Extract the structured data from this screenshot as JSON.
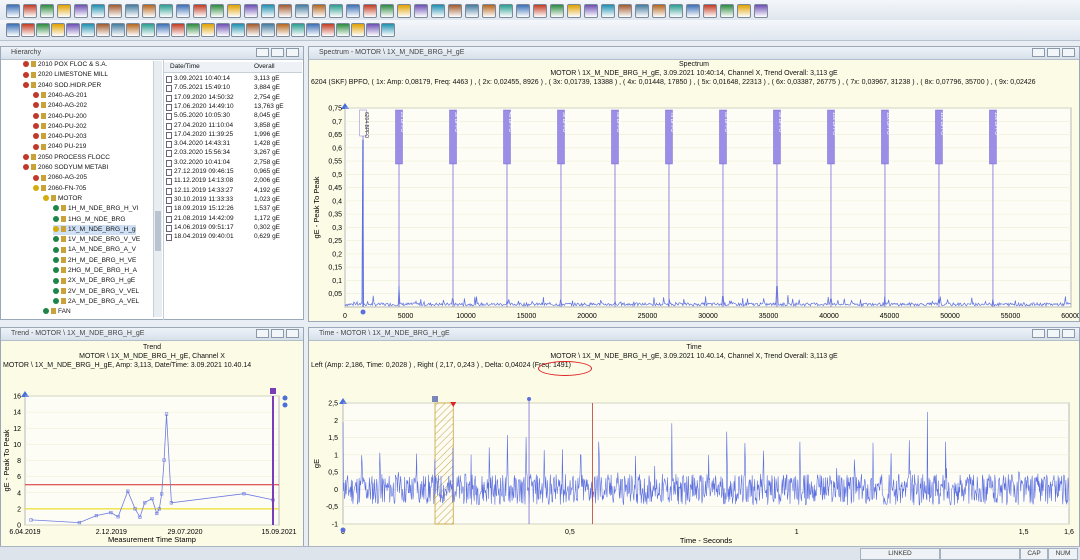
{
  "hierarchy": {
    "title": "Hierarchy",
    "items": [
      {
        "label": "2010 POX FLOC & S.A.",
        "indent": 0,
        "status": "#c0392b"
      },
      {
        "label": "2020 LIMESTONE MILL",
        "indent": 0,
        "status": "#c0392b"
      },
      {
        "label": "2040 SOD.HIDR.PER",
        "indent": 0,
        "status": "#c0392b"
      },
      {
        "label": "2040-AG-201",
        "indent": 1,
        "status": "#c0392b"
      },
      {
        "label": "2040-AG-202",
        "indent": 1,
        "status": "#c0392b"
      },
      {
        "label": "2040-PU-200",
        "indent": 1,
        "status": "#c0392b"
      },
      {
        "label": "2040-PU-202",
        "indent": 1,
        "status": "#c0392b"
      },
      {
        "label": "2040-PU-203",
        "indent": 1,
        "status": "#c0392b"
      },
      {
        "label": "2040 PU-219",
        "indent": 1,
        "status": "#c0392b"
      },
      {
        "label": "2050 PROCESS FLOCC",
        "indent": 0,
        "status": "#c0392b"
      },
      {
        "label": "2060 SODYUM METABI",
        "indent": 0,
        "status": "#c0392b"
      },
      {
        "label": "2060-AG-205",
        "indent": 1,
        "status": "#c0392b"
      },
      {
        "label": "2060-FN-705",
        "indent": 1,
        "status": "#d4ac0d"
      },
      {
        "label": "MOTOR",
        "indent": 2,
        "status": "#d4ac0d"
      },
      {
        "label": "1H_M_NDE_BRG_H_VI",
        "indent": 3,
        "status": "#1e8449"
      },
      {
        "label": "1HG_M_NDE_BRG",
        "indent": 3,
        "status": "#1e8449"
      },
      {
        "label": "1X_M_NDE_BRG_H_g",
        "indent": 3,
        "status": "#d4ac0d"
      },
      {
        "label": "1V_M_NDE_BRG_V_VE",
        "indent": 3,
        "status": "#1e8449"
      },
      {
        "label": "1A_M_NDE_BRG_A_V",
        "indent": 3,
        "status": "#1e8449"
      },
      {
        "label": "2H_M_DE_BRG_H_VE",
        "indent": 3,
        "status": "#1e8449"
      },
      {
        "label": "2HG_M_DE_BRG_H_A",
        "indent": 3,
        "status": "#1e8449"
      },
      {
        "label": "2X_M_DE_BRG_H_gE",
        "indent": 3,
        "status": "#1e8449"
      },
      {
        "label": "2V_M_DE_BRG_V_VEL",
        "indent": 3,
        "status": "#1e8449"
      },
      {
        "label": "2A_M_DE_BRG_A_VEL",
        "indent": 3,
        "status": "#1e8449"
      },
      {
        "label": "FAN",
        "indent": 2,
        "status": "#1e8449"
      }
    ]
  },
  "datetime_list": {
    "headers": [
      "Date/Time",
      "Overall"
    ],
    "rows": [
      [
        "3.09.2021 10:40:14",
        "3,113 gE"
      ],
      [
        "7.05.2021 15:49:10",
        "3,884 gE"
      ],
      [
        "17.09.2020 14:50:32",
        "2,754 gE"
      ],
      [
        "17.06.2020 14:49:10",
        "13,763 gE"
      ],
      [
        "5.05.2020 10:05:30",
        "8,045 gE"
      ],
      [
        "27.04.2020 11:10:04",
        "3,858 gE"
      ],
      [
        "17.04.2020 11:39:25",
        "1,996 gE"
      ],
      [
        "3.04.2020 14:43:31",
        "1,428 gE"
      ],
      [
        "2.03.2020 15:56:34",
        "3,267 gE"
      ],
      [
        "3.02.2020 10:41:04",
        "2,758 gE"
      ],
      [
        "27.12.2019 09:46:15",
        "0,965 gE"
      ],
      [
        "11.12.2019 14:13:08",
        "2,006 gE"
      ],
      [
        "12.11.2019 14:33:27",
        "4,192 gE"
      ],
      [
        "30.10.2019 11:33:33",
        "1,023 gE"
      ],
      [
        "18.09.2019 15:12:26",
        "1,537 gE"
      ],
      [
        "21.08.2019 14:42:09",
        "1,172 gE"
      ],
      [
        "14.06.2019 09:51:17",
        "0,302 gE"
      ],
      [
        "18.04.2019 09:40:01",
        "0,629 gE"
      ]
    ]
  },
  "spectrum": {
    "window_title": "Spectrum - MOTOR \\ 1X_M_NDE_BRG_H_gE",
    "title": "Spectrum",
    "subtitle": "MOTOR \\ 1X_M_NDE_BRG_H_gE, 3.09.2021 10:40:14, Channel X, Trend Overall: 3,113 gE",
    "info": "6204 (SKF) BPFO, ( 1x:  Amp: 0,08179, Freq: 4463 ) , ( 2x:  0,02455, 8926 ) , ( 3x:  0,01739, 13388 ) , ( 4x:  0,01448, 17850 ) , ( 5x:  0,01648, 22313 ) , ( 6x:  0,03387, 26775 ) , ( 7x:  0,03967, 31238 ) , ( 8x:  0,07796, 35700 ) , ( 9x:  0,02426",
    "marker_labels": [
      "6204 BPFO",
      "2x BPFO",
      "3x BPFO",
      "4x BPFO",
      "5x BPFO",
      "6x BPFO",
      "7x BPFO",
      "8x BPFO",
      "9x BPFO",
      "10x BPFO",
      "11x BPFO",
      "12x BPFO",
      "13x BPFO"
    ]
  },
  "trend": {
    "window_title": "Trend - MOTOR \\ 1X_M_NDE_BRG_H_gE",
    "title": "Trend",
    "subtitle": "MOTOR \\ 1X_M_NDE_BRG_H_gE, Channel X",
    "info": "MOTOR \\ 1X_M_NDE_BRG_H_gE, Amp: 3,113, Date/Time: 3.09.2021 10.40.14"
  },
  "time": {
    "window_title": "Time - MOTOR \\ 1X_M_NDE_BRG_H_gE",
    "title": "Time",
    "subtitle": "MOTOR \\ 1X_M_NDE_BRG_H_gE, 3.09.2021 10.40.14, Channel X, Trend Overall: 3,113 gE",
    "info": "Left (Amp: 2,186, Time: 0,2028 ) , Right (  2,17,  0,243 ) , Delta: 0,04024 (Freq: 1491)"
  },
  "status_bar": {
    "linked": "LINKED",
    "cap": "CAP",
    "num": "NUM"
  },
  "chart_data": [
    {
      "type": "line",
      "title": "Spectrum",
      "xlabel": "Frequency - CPM",
      "ylabel": "gE - Peak To Peak",
      "xlim": [
        0,
        60000
      ],
      "ylim": [
        0,
        0.75
      ],
      "x_ticks": [
        0,
        5000,
        10000,
        15000,
        20000,
        25000,
        30000,
        35000,
        40000,
        45000,
        50000,
        55000,
        60000
      ],
      "y_ticks": [
        0.05,
        0.1,
        0.15,
        0.2,
        0.25,
        0.3,
        0.35,
        0.4,
        0.45,
        0.5,
        0.55,
        0.6,
        0.65,
        0.7,
        0.75
      ],
      "bpfo_markers_cpm": [
        1491,
        4463,
        8926,
        13388,
        17850,
        22313,
        26775,
        31238,
        35700,
        40163,
        44625,
        49088,
        53550
      ],
      "peaks": [
        {
          "x": 1491,
          "y": 0.63
        },
        {
          "x": 4463,
          "y": 0.08
        },
        {
          "x": 8926,
          "y": 0.03
        },
        {
          "x": 13388,
          "y": 0.025
        },
        {
          "x": 17850,
          "y": 0.02
        },
        {
          "x": 22313,
          "y": 0.02
        },
        {
          "x": 26775,
          "y": 0.03
        },
        {
          "x": 31238,
          "y": 0.04
        },
        {
          "x": 35700,
          "y": 0.078
        },
        {
          "x": 40163,
          "y": 0.03
        },
        {
          "x": 44625,
          "y": 0.04
        },
        {
          "x": 49088,
          "y": 0.03
        },
        {
          "x": 53550,
          "y": 0.03
        },
        {
          "x": 28000,
          "y": 0.03
        },
        {
          "x": 29800,
          "y": 0.04
        }
      ]
    },
    {
      "type": "line",
      "title": "Trend",
      "xlabel": "Measurement Time Stamp",
      "ylabel": "gE - Peak To Peak",
      "ylim": [
        0,
        16
      ],
      "y_ticks": [
        0,
        2,
        4,
        6,
        8,
        10,
        12,
        14,
        16
      ],
      "x_tick_labels": [
        "6.04.2019",
        "2.12.2019",
        "29.07.2020",
        "15.09.2021"
      ],
      "alarm_levels": [
        5,
        2
      ],
      "alarm_colors": [
        "#d62728",
        "#e8d800"
      ],
      "series": [
        {
          "values": [
            0.63,
            0.3,
            1.17,
            1.54,
            1.02,
            4.19,
            2.01,
            0.97,
            2.76,
            3.27,
            1.43,
            2.0,
            3.86,
            8.05,
            13.76,
            2.75,
            3.88,
            3.11
          ]
        }
      ]
    },
    {
      "type": "line",
      "title": "Time",
      "xlabel": "Time - Seconds",
      "ylabel": "gE",
      "xlim": [
        0,
        1.6
      ],
      "ylim": [
        -1,
        2.5
      ],
      "x_tick_labels": [
        "0",
        "0,5",
        "1",
        "1,5",
        "1,6"
      ],
      "y_ticks": [
        -1,
        -0.5,
        0,
        0.5,
        1,
        1.5,
        2,
        2.5
      ],
      "cursor_left_s": 0.2028,
      "cursor_right_s": 0.243,
      "cursor_delta_s": 0.04024,
      "cursor_freq_cpm": 1491
    }
  ]
}
